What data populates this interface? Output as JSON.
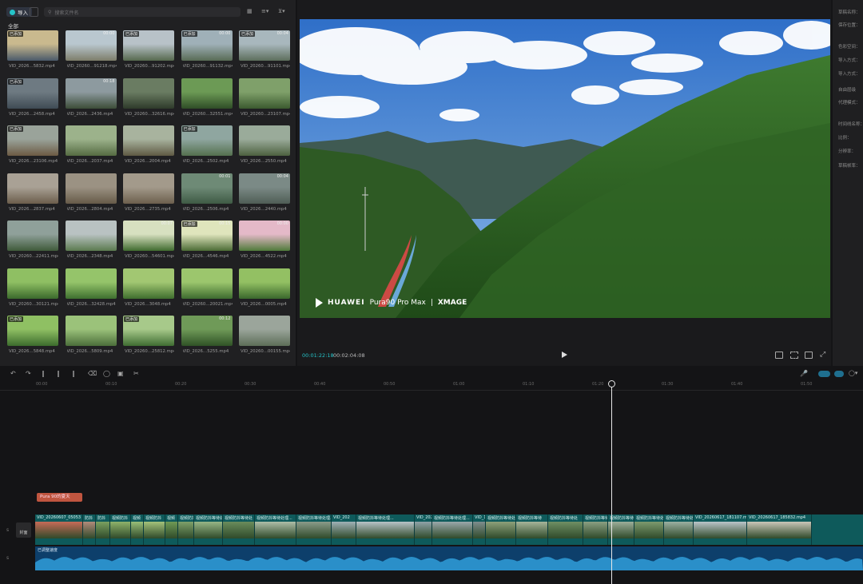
{
  "media": {
    "import_label": "导入",
    "search_placeholder": "搜索文件名",
    "all_label": "全部",
    "items": [
      {
        "name": "VID_2026…5832.mp4",
        "added": "已添加",
        "dur": "",
        "c": [
          "#c9b98e",
          "#4a5a6a"
        ]
      },
      {
        "name": "VID_20260…91218.mp4",
        "added": "",
        "dur": "00:00",
        "c": [
          "#b9c7cf",
          "#7d7d6a"
        ]
      },
      {
        "name": "VID_20260…91202.mp4",
        "added": "已添加",
        "dur": "",
        "c": [
          "#b8c2c8",
          "#56694d"
        ]
      },
      {
        "name": "VID_20260…91132.mp4",
        "added": "已添加",
        "dur": "00:00",
        "c": [
          "#9fb0b8",
          "#586b55"
        ]
      },
      {
        "name": "VID_20260…91101.mp4",
        "added": "已添加",
        "dur": "00:04",
        "c": [
          "#a8b7bd",
          "#5d6e5c"
        ]
      },
      {
        "name": "VID_2026…2458.mp4",
        "added": "已添加",
        "dur": "",
        "c": [
          "#6e7a82",
          "#3f4b54"
        ]
      },
      {
        "name": "VID_2026…2436.mp4",
        "added": "",
        "dur": "00:18",
        "c": [
          "#8d9a9f",
          "#3c4c38"
        ]
      },
      {
        "name": "VID_20260…32616.mp4",
        "added": "",
        "dur": "",
        "c": [
          "#6a7c62",
          "#2e3a2a"
        ]
      },
      {
        "name": "VID_20260…32551.mp4",
        "added": "",
        "dur": "",
        "c": [
          "#6c9a55",
          "#2f4d27"
        ]
      },
      {
        "name": "VID_20260…23107.mp4",
        "added": "",
        "dur": "",
        "c": [
          "#7fa06a",
          "#3b5a2f"
        ]
      },
      {
        "name": "VID_2026…23106.mp4",
        "added": "已添加",
        "dur": "",
        "c": [
          "#9aa39a",
          "#6c5a44"
        ]
      },
      {
        "name": "VID_2026…2037.mp4",
        "added": "",
        "dur": "",
        "c": [
          "#9cb28b",
          "#556b42"
        ]
      },
      {
        "name": "VID_2026…2004.mp4",
        "added": "",
        "dur": "",
        "c": [
          "#a8b39e",
          "#5f5a44"
        ]
      },
      {
        "name": "VID_2026…2502.mp4",
        "added": "已添加",
        "dur": "",
        "c": [
          "#8fa6a0",
          "#54704e"
        ]
      },
      {
        "name": "VID_2026…2550.mp4",
        "added": "",
        "dur": "",
        "c": [
          "#9aab9a",
          "#4d6140"
        ]
      },
      {
        "name": "VID_2026…2837.mp4",
        "added": "",
        "dur": "",
        "c": [
          "#a9a195",
          "#6b5d4b"
        ]
      },
      {
        "name": "VID_2026…2804.mp4",
        "added": "",
        "dur": "",
        "c": [
          "#9b9283",
          "#665a48"
        ]
      },
      {
        "name": "VID_2026…2735.mp4",
        "added": "",
        "dur": "",
        "c": [
          "#a39a8b",
          "#6c5f4d"
        ]
      },
      {
        "name": "VID_2026…2506.mp4",
        "added": "",
        "dur": "00:01",
        "c": [
          "#6e8a76",
          "#3e5a44"
        ]
      },
      {
        "name": "VID_2026…2440.mp4",
        "added": "",
        "dur": "00:04",
        "c": [
          "#7b8a86",
          "#4f5d55"
        ]
      },
      {
        "name": "VID_20260…22411.mp4",
        "added": "",
        "dur": "",
        "c": [
          "#8fa09a",
          "#3f5a3a"
        ]
      },
      {
        "name": "VID_2026…2348.mp4",
        "added": "",
        "dur": "",
        "c": [
          "#b9c2c2",
          "#5b7a4f"
        ]
      },
      {
        "name": "VID_20260…54601.mp4",
        "added": "",
        "dur": "00:07",
        "c": [
          "#d7e0c0",
          "#3f6b2e"
        ]
      },
      {
        "name": "VID_2026…4546.mp4",
        "added": "已添加",
        "dur": "00:15",
        "c": [
          "#dfe5bc",
          "#4b6b35"
        ]
      },
      {
        "name": "VID_2026…4522.mp4",
        "added": "",
        "dur": "00:00",
        "c": [
          "#e4b9c8",
          "#4f7a3a"
        ]
      },
      {
        "name": "VID_20260…30121.mp4",
        "added": "",
        "dur": "",
        "c": [
          "#8fbf63",
          "#3b6a2c"
        ]
      },
      {
        "name": "VID_2026…32428.mp4",
        "added": "",
        "dur": "",
        "c": [
          "#95c46a",
          "#3e6f2f"
        ]
      },
      {
        "name": "VID_2026…3048.mp4",
        "added": "",
        "dur": "",
        "c": [
          "#a2c772",
          "#3f6e2e"
        ]
      },
      {
        "name": "VID_20260…20021.mp4",
        "added": "",
        "dur": "",
        "c": [
          "#9cc66d",
          "#3d6b2f"
        ]
      },
      {
        "name": "VID_2026…0005.mp4",
        "added": "",
        "dur": "",
        "c": [
          "#93c063",
          "#3a682c"
        ]
      },
      {
        "name": "VID_2026…5848.mp4",
        "added": "已添加",
        "dur": "",
        "c": [
          "#8fc063",
          "#3c6c2d"
        ]
      },
      {
        "name": "VID_2026…5809.mp4",
        "added": "",
        "dur": "",
        "c": [
          "#9bc27a",
          "#4b6e3a"
        ]
      },
      {
        "name": "VID_20260…25812.mp4",
        "added": "已添加",
        "dur": "",
        "c": [
          "#a7c98a",
          "#3f6d32"
        ]
      },
      {
        "name": "VID_2026…5255.mp4",
        "added": "",
        "dur": "00:12",
        "c": [
          "#6f9a58",
          "#2f5226"
        ]
      },
      {
        "name": "VID_20260…00155.mp4",
        "added": "",
        "dur": "",
        "c": [
          "#9ba59b",
          "#5d6e58"
        ]
      }
    ]
  },
  "preview": {
    "watermark_brand": "HUAWEI",
    "watermark_model": "Pura90 Pro Max",
    "watermark_tag": "XMAGE",
    "current_time": "00:01:22:18",
    "total_time": "00:02:04:08"
  },
  "props": {
    "labels": [
      "草稿名称：",
      "保存位置：",
      "色彩空间：",
      "导入方式：",
      "导入方式：",
      "自由层级",
      "代理模式：",
      "时间线名称：",
      "比例：",
      "分辨率：",
      "草稿帧率："
    ]
  },
  "timeline": {
    "ticks": [
      "00:00",
      "00:10",
      "00:20",
      "00:30",
      "00:40",
      "00:50",
      "01:00",
      "01:10",
      "01:20",
      "01:30",
      "01:40",
      "01:50"
    ],
    "text_clip": "Pura 90的夏天",
    "cover_label": "封面",
    "audio_label": "已调整速度",
    "segments": [
      {
        "lbl": "VID_20260607_05053",
        "w": 60,
        "c": "#c66b57"
      },
      {
        "lbl": "防抖",
        "w": 16,
        "c": "#b18a7a"
      },
      {
        "lbl": "防抖",
        "w": 18,
        "c": "#7aa060"
      },
      {
        "lbl": "视频防抖",
        "w": 26,
        "c": "#8fb36a"
      },
      {
        "lbl": "视频",
        "w": 16,
        "c": "#99bf78"
      },
      {
        "lbl": "视频防抖",
        "w": 27,
        "c": "#a4c27a"
      },
      {
        "lbl": "视频",
        "w": 16,
        "c": "#6e9a55"
      },
      {
        "lbl": "视频防抖",
        "w": 20,
        "c": "#7ea06a"
      },
      {
        "lbl": "视频防抖等待处",
        "w": 36,
        "c": "#97b686"
      },
      {
        "lbl": "视频防抖等待处",
        "w": 40,
        "c": "#6a8c5c"
      },
      {
        "lbl": "视频防抖等待处理...",
        "w": 52,
        "c": "#aebea8"
      },
      {
        "lbl": "视频防抖等待处理...",
        "w": 44,
        "c": "#8a9b8a"
      },
      {
        "lbl": "VID_202",
        "w": 31,
        "c": "#9fb1b6"
      },
      {
        "lbl": "视频防抖等待处理...",
        "w": 73,
        "c": "#b7c3c7"
      },
      {
        "lbl": "VID_202",
        "w": 22,
        "c": "#8fa3a8"
      },
      {
        "lbl": "视频防抖等待处理...",
        "w": 51,
        "c": "#9aa8ab"
      },
      {
        "lbl": "VID_1",
        "w": 16,
        "c": "#7e8d8e"
      },
      {
        "lbl": "视频防抖等待处",
        "w": 38,
        "c": "#8da07a"
      },
      {
        "lbl": "视频防抖等待",
        "w": 40,
        "c": "#a6b59a"
      },
      {
        "lbl": "视频防抖等待处",
        "w": 44,
        "c": "#6f8f64"
      },
      {
        "lbl": "视频防抖等待处",
        "w": 31,
        "c": "#8a9f82"
      },
      {
        "lbl": "视频防抖等待处",
        "w": 33,
        "c": "#9cae9a"
      },
      {
        "lbl": "视频防抖等待处",
        "w": 37,
        "c": "#7d9a6e"
      },
      {
        "lbl": "视频防抖等待处",
        "w": 37,
        "c": "#9bb0a2"
      },
      {
        "lbl": "VID_20260617_181107.mp",
        "w": 67,
        "c": "#bac5c9"
      },
      {
        "lbl": "VID_20260617_185832.mp4",
        "w": 81,
        "c": "#c9c6b8"
      }
    ]
  },
  "colors": {
    "accent": "#25c4c9",
    "text_clip": "#c0553f",
    "video_track": "#0e5a5b",
    "audio_track": "#0d3f6b"
  }
}
